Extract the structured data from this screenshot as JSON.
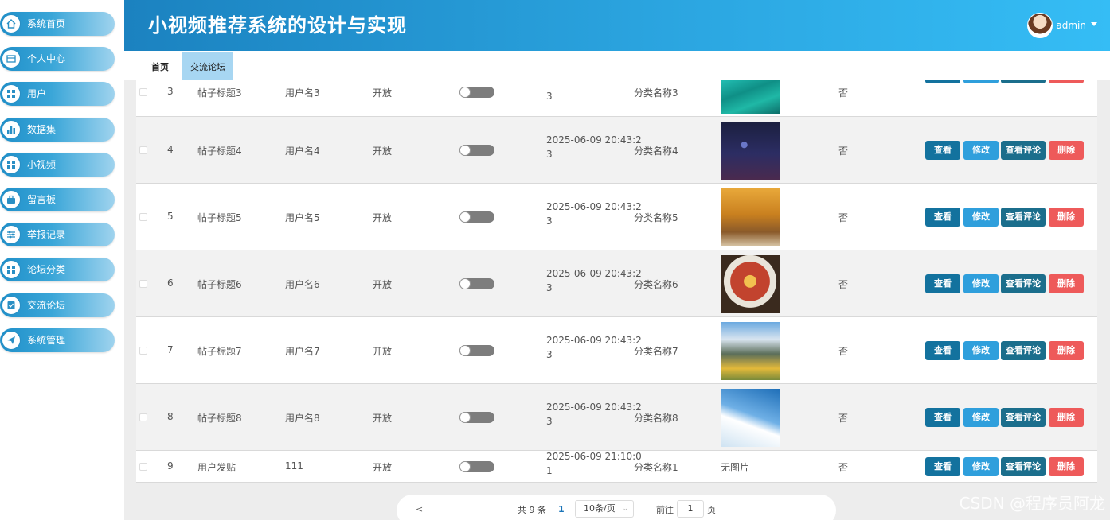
{
  "app_title": "小视频推荐系统的设计与实现",
  "user": {
    "name": "admin"
  },
  "sidebar": {
    "items": [
      {
        "label": "系统首页",
        "icon": "home-icon"
      },
      {
        "label": "个人中心",
        "icon": "card-icon"
      },
      {
        "label": "用户",
        "icon": "grid-icon"
      },
      {
        "label": "数据集",
        "icon": "bar-chart-icon"
      },
      {
        "label": "小视频",
        "icon": "grid-icon"
      },
      {
        "label": "留言板",
        "icon": "briefcase-icon"
      },
      {
        "label": "举报记录",
        "icon": "sliders-icon"
      },
      {
        "label": "论坛分类",
        "icon": "grid-icon"
      },
      {
        "label": "交流论坛",
        "icon": "checklist-icon"
      },
      {
        "label": "系统管理",
        "icon": "send-icon"
      }
    ]
  },
  "tabs": [
    {
      "label": "首页"
    },
    {
      "label": "交流论坛"
    }
  ],
  "buttons": {
    "view": "查看",
    "edit": "修改",
    "comments": "查看评论",
    "delete": "删除"
  },
  "rows": [
    {
      "index": "3",
      "title": "帖子标题3",
      "user": "用户名3",
      "status": "开放",
      "time_line1": "",
      "time_line2": "3",
      "category": "分类名称3",
      "image": "lagoon",
      "top": "否"
    },
    {
      "index": "4",
      "title": "帖子标题4",
      "user": "用户名4",
      "status": "开放",
      "time_line1": "2025-06-09 20:43:2",
      "time_line2": "3",
      "category": "分类名称4",
      "image": "night",
      "top": "否"
    },
    {
      "index": "5",
      "title": "帖子标题5",
      "user": "用户名5",
      "status": "开放",
      "time_line1": "2025-06-09 20:43:2",
      "time_line2": "3",
      "category": "分类名称5",
      "image": "autumn",
      "top": "否"
    },
    {
      "index": "6",
      "title": "帖子标题6",
      "user": "用户名6",
      "status": "开放",
      "time_line1": "2025-06-09 20:43:2",
      "time_line2": "3",
      "category": "分类名称6",
      "image": "food",
      "top": "否"
    },
    {
      "index": "7",
      "title": "帖子标题7",
      "user": "用户名7",
      "status": "开放",
      "time_line1": "2025-06-09 20:43:2",
      "time_line2": "3",
      "category": "分类名称7",
      "image": "mountain",
      "top": "否"
    },
    {
      "index": "8",
      "title": "帖子标题8",
      "user": "用户名8",
      "status": "开放",
      "time_line1": "2025-06-09 20:43:2",
      "time_line2": "3",
      "category": "分类名称8",
      "image": "ski",
      "top": "否"
    },
    {
      "index": "9",
      "title": "用户发贴",
      "user": "111",
      "status": "开放",
      "time_line1": "2025-06-09 21:10:0",
      "time_line2": "1",
      "category": "分类名称1",
      "image_text": "无图片",
      "top": "否"
    }
  ],
  "pagination": {
    "prev": "<",
    "total": "共 9 条",
    "current": "1",
    "page_size": "10条/页",
    "goto": "前往",
    "goto_value": "1",
    "unit": "页"
  },
  "watermark": "CSDN @程序员阿龙",
  "colors": {
    "header_start": "#1b82c0",
    "header_end": "#35bdf5",
    "delete": "#ee5a5a",
    "view": "#13729e"
  }
}
